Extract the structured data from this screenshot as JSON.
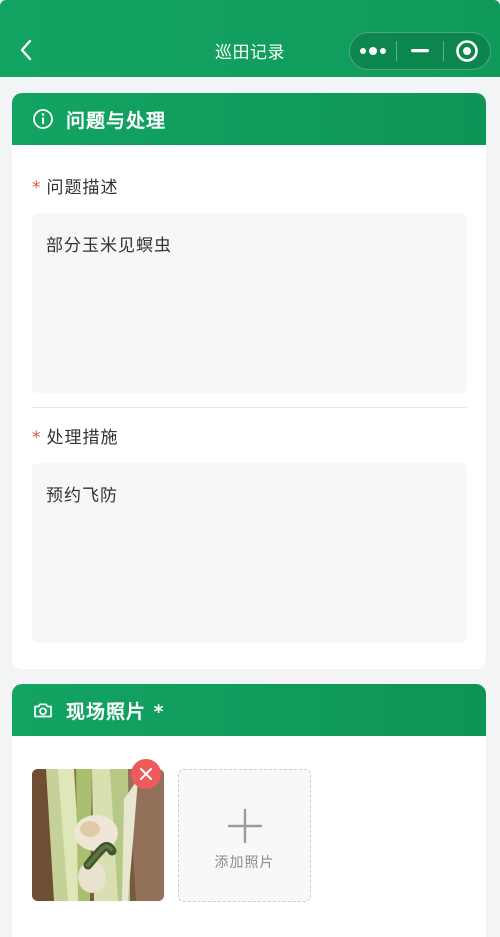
{
  "nav": {
    "title": "巡田记录",
    "back_icon": "chevron-left-icon",
    "more_icon": "more-dots-icon",
    "minimize_icon": "minimize-icon",
    "close_icon": "target-circle-icon"
  },
  "problem_section": {
    "title": "问题与处理",
    "icon": "info-circle-icon",
    "description": {
      "required_mark": "*",
      "label": "问题描述",
      "value": "部分玉米见螟虫"
    },
    "measures": {
      "required_mark": "*",
      "label": "处理措施",
      "value": "预约飞防"
    }
  },
  "photo_section": {
    "title": "现场照片 *",
    "icon": "camera-icon",
    "add_label": "添加照片",
    "delete_icon": "close-icon",
    "photo_icon": "photo-thumbnail"
  },
  "colors": {
    "brand_green": "#12a463",
    "danger_red": "#ee5b5b",
    "required_red": "#e05252"
  }
}
